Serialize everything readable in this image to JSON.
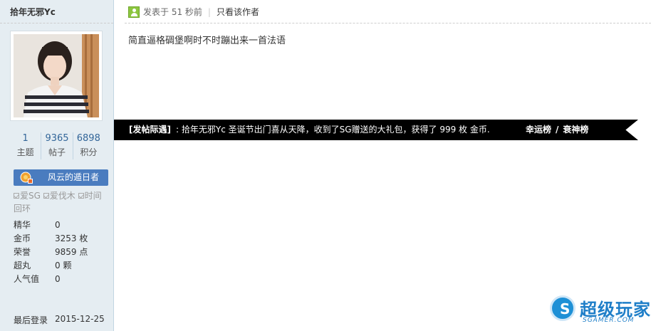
{
  "sidebar": {
    "username": "拾年无邪Yc",
    "stats": [
      {
        "value": "1",
        "label": "主题"
      },
      {
        "value": "9365",
        "label": "帖子"
      },
      {
        "value": "6898",
        "label": "积分"
      }
    ],
    "group": "风云的遁日者",
    "medals": [
      "爱SG",
      "爱伐木",
      "时间回环"
    ],
    "profile": [
      {
        "key": "精华",
        "value": "0"
      },
      {
        "key": "金币",
        "value": "3253 枚"
      },
      {
        "key": "荣誉",
        "value": "9859 点"
      },
      {
        "key": "超丸",
        "value": "0 颗"
      },
      {
        "key": "人气值",
        "value": "0"
      }
    ],
    "last_login": {
      "key": "最后登录",
      "value": "2015-12-25"
    }
  },
  "post": {
    "posted": "发表于 51 秒前",
    "separator": "|",
    "author_only": "只看该作者",
    "content": "简直逼格碉堡啊时不时蹦出来一首法语"
  },
  "ribbon": {
    "title": "[发帖际遇]",
    "message": ": 拾年无邪Yc 圣诞节出门喜从天降，收到了SG赠送的大礼包，获得了 999 枚 金币.",
    "link_lucky": "幸运榜",
    "link_sep": "/",
    "link_unlucky": "衰神榜"
  },
  "watermark": {
    "logo_letter": "S",
    "text": "超级玩家",
    "sub": "SGAMER.COM"
  },
  "colors": {
    "sidebar_bg": "#e5edf2",
    "stat_number": "#336699",
    "group_badge": "#4a7cbf",
    "ribbon_bg": "#000000",
    "watermark_blue": "#1e7ec8"
  }
}
